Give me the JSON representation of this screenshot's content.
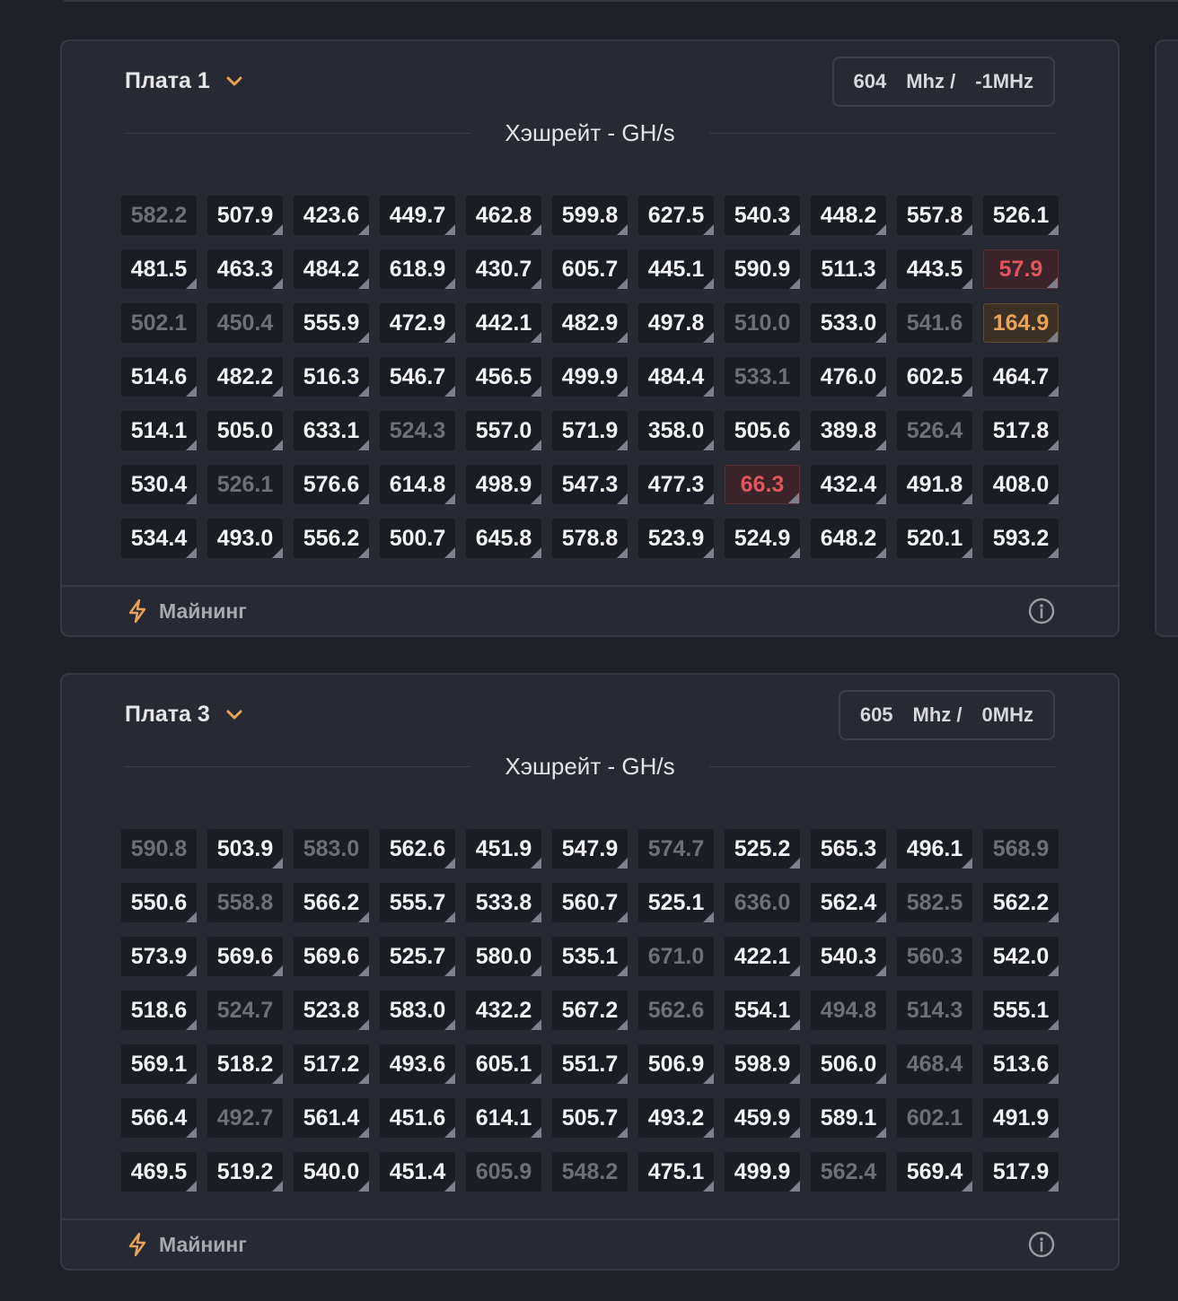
{
  "colors": {
    "accent": "#e9a25a",
    "error": "#e0555f",
    "background": "#1e2128",
    "card": "#272a32"
  },
  "boards": [
    {
      "title": "Плата 1",
      "freq": {
        "value": "604",
        "unit": "Mhz /",
        "offset": "-1MHz"
      },
      "section_label": "Хэшрейт - GH/s",
      "status_label": "Майнинг",
      "rows": [
        [
          [
            "582.2",
            "d"
          ],
          [
            "507.9",
            "n"
          ],
          [
            "423.6",
            "n"
          ],
          [
            "449.7",
            "n"
          ],
          [
            "462.8",
            "n"
          ],
          [
            "599.8",
            "n"
          ],
          [
            "627.5",
            "n"
          ],
          [
            "540.3",
            "n"
          ],
          [
            "448.2",
            "n"
          ],
          [
            "557.8",
            "n"
          ],
          [
            "526.1",
            "n"
          ]
        ],
        [
          [
            "481.5",
            "n"
          ],
          [
            "463.3",
            "n"
          ],
          [
            "484.2",
            "n"
          ],
          [
            "618.9",
            "n"
          ],
          [
            "430.7",
            "n"
          ],
          [
            "605.7",
            "n"
          ],
          [
            "445.1",
            "n"
          ],
          [
            "590.9",
            "n"
          ],
          [
            "511.3",
            "n"
          ],
          [
            "443.5",
            "n"
          ],
          [
            "57.9",
            "e"
          ]
        ],
        [
          [
            "502.1",
            "d"
          ],
          [
            "450.4",
            "d"
          ],
          [
            "555.9",
            "n"
          ],
          [
            "472.9",
            "n"
          ],
          [
            "442.1",
            "n"
          ],
          [
            "482.9",
            "n"
          ],
          [
            "497.8",
            "n"
          ],
          [
            "510.0",
            "d"
          ],
          [
            "533.0",
            "n"
          ],
          [
            "541.6",
            "d"
          ],
          [
            "164.9",
            "w"
          ]
        ],
        [
          [
            "514.6",
            "n"
          ],
          [
            "482.2",
            "n"
          ],
          [
            "516.3",
            "n"
          ],
          [
            "546.7",
            "n"
          ],
          [
            "456.5",
            "n"
          ],
          [
            "499.9",
            "n"
          ],
          [
            "484.4",
            "n"
          ],
          [
            "533.1",
            "d"
          ],
          [
            "476.0",
            "n"
          ],
          [
            "602.5",
            "n"
          ],
          [
            "464.7",
            "n"
          ]
        ],
        [
          [
            "514.1",
            "n"
          ],
          [
            "505.0",
            "n"
          ],
          [
            "633.1",
            "n"
          ],
          [
            "524.3",
            "d"
          ],
          [
            "557.0",
            "n"
          ],
          [
            "571.9",
            "n"
          ],
          [
            "358.0",
            "n"
          ],
          [
            "505.6",
            "n"
          ],
          [
            "389.8",
            "n"
          ],
          [
            "526.4",
            "d"
          ],
          [
            "517.8",
            "n"
          ]
        ],
        [
          [
            "530.4",
            "n"
          ],
          [
            "526.1",
            "d"
          ],
          [
            "576.6",
            "n"
          ],
          [
            "614.8",
            "n"
          ],
          [
            "498.9",
            "n"
          ],
          [
            "547.3",
            "n"
          ],
          [
            "477.3",
            "n"
          ],
          [
            "66.3",
            "e"
          ],
          [
            "432.4",
            "n"
          ],
          [
            "491.8",
            "n"
          ],
          [
            "408.0",
            "n"
          ]
        ],
        [
          [
            "534.4",
            "n"
          ],
          [
            "493.0",
            "n"
          ],
          [
            "556.2",
            "n"
          ],
          [
            "500.7",
            "n"
          ],
          [
            "645.8",
            "n"
          ],
          [
            "578.8",
            "n"
          ],
          [
            "523.9",
            "n"
          ],
          [
            "524.9",
            "n"
          ],
          [
            "648.2",
            "n"
          ],
          [
            "520.1",
            "n"
          ],
          [
            "593.2",
            "n"
          ]
        ]
      ]
    },
    {
      "title": "Плата 3",
      "freq": {
        "value": "605",
        "unit": "Mhz /",
        "offset": "0MHz"
      },
      "section_label": "Хэшрейт - GH/s",
      "status_label": "Майнинг",
      "rows": [
        [
          [
            "590.8",
            "d"
          ],
          [
            "503.9",
            "n"
          ],
          [
            "583.0",
            "d"
          ],
          [
            "562.6",
            "n"
          ],
          [
            "451.9",
            "n"
          ],
          [
            "547.9",
            "n"
          ],
          [
            "574.7",
            "d"
          ],
          [
            "525.2",
            "n"
          ],
          [
            "565.3",
            "n"
          ],
          [
            "496.1",
            "n"
          ],
          [
            "568.9",
            "d"
          ]
        ],
        [
          [
            "550.6",
            "n"
          ],
          [
            "558.8",
            "d"
          ],
          [
            "566.2",
            "n"
          ],
          [
            "555.7",
            "n"
          ],
          [
            "533.8",
            "n"
          ],
          [
            "560.7",
            "n"
          ],
          [
            "525.1",
            "n"
          ],
          [
            "636.0",
            "d"
          ],
          [
            "562.4",
            "n"
          ],
          [
            "582.5",
            "d"
          ],
          [
            "562.2",
            "n"
          ]
        ],
        [
          [
            "573.9",
            "n"
          ],
          [
            "569.6",
            "n"
          ],
          [
            "569.6",
            "n"
          ],
          [
            "525.7",
            "n"
          ],
          [
            "580.0",
            "n"
          ],
          [
            "535.1",
            "n"
          ],
          [
            "671.0",
            "d"
          ],
          [
            "422.1",
            "n"
          ],
          [
            "540.3",
            "n"
          ],
          [
            "560.3",
            "d"
          ],
          [
            "542.0",
            "n"
          ]
        ],
        [
          [
            "518.6",
            "n"
          ],
          [
            "524.7",
            "d"
          ],
          [
            "523.8",
            "n"
          ],
          [
            "583.0",
            "n"
          ],
          [
            "432.2",
            "n"
          ],
          [
            "567.2",
            "n"
          ],
          [
            "562.6",
            "d"
          ],
          [
            "554.1",
            "n"
          ],
          [
            "494.8",
            "d"
          ],
          [
            "514.3",
            "d"
          ],
          [
            "555.1",
            "n"
          ]
        ],
        [
          [
            "569.1",
            "n"
          ],
          [
            "518.2",
            "n"
          ],
          [
            "517.2",
            "n"
          ],
          [
            "493.6",
            "n"
          ],
          [
            "605.1",
            "n"
          ],
          [
            "551.7",
            "n"
          ],
          [
            "506.9",
            "n"
          ],
          [
            "598.9",
            "n"
          ],
          [
            "506.0",
            "n"
          ],
          [
            "468.4",
            "d"
          ],
          [
            "513.6",
            "n"
          ]
        ],
        [
          [
            "566.4",
            "n"
          ],
          [
            "492.7",
            "d"
          ],
          [
            "561.4",
            "n"
          ],
          [
            "451.6",
            "n"
          ],
          [
            "614.1",
            "n"
          ],
          [
            "505.7",
            "n"
          ],
          [
            "493.2",
            "n"
          ],
          [
            "459.9",
            "n"
          ],
          [
            "589.1",
            "n"
          ],
          [
            "602.1",
            "d"
          ],
          [
            "491.9",
            "n"
          ]
        ],
        [
          [
            "469.5",
            "n"
          ],
          [
            "519.2",
            "n"
          ],
          [
            "540.0",
            "n"
          ],
          [
            "451.4",
            "n"
          ],
          [
            "605.9",
            "d"
          ],
          [
            "548.2",
            "d"
          ],
          [
            "475.1",
            "n"
          ],
          [
            "499.9",
            "n"
          ],
          [
            "562.4",
            "d"
          ],
          [
            "569.4",
            "n"
          ],
          [
            "517.9",
            "n"
          ]
        ]
      ]
    }
  ]
}
